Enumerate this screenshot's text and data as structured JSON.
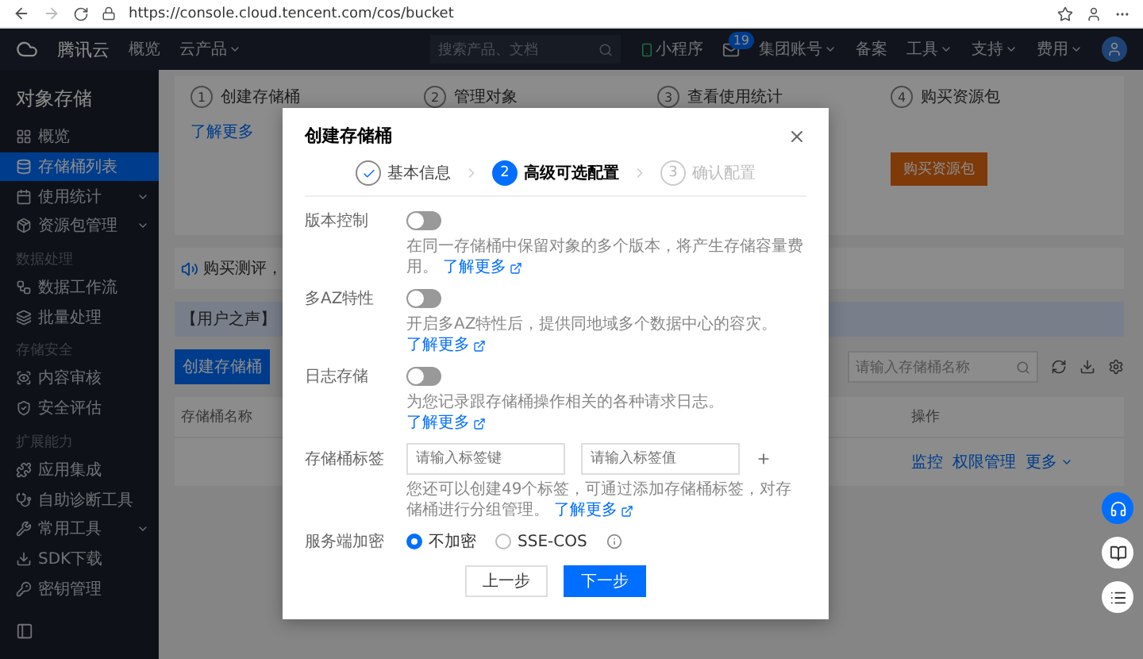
{
  "browser": {
    "url": "https://console.cloud.tencent.com/cos/bucket"
  },
  "topnav": {
    "brand": "腾讯云",
    "links": [
      {
        "label": "概览",
        "dropdown": false
      },
      {
        "label": "云产品",
        "dropdown": true
      }
    ],
    "search": {
      "placeholder": "搜索产品、文档"
    },
    "items": [
      {
        "kind": "mini",
        "label": "小程序"
      },
      {
        "kind": "mail",
        "badge": "19"
      },
      {
        "kind": "link",
        "label": "集团账号",
        "dropdown": true
      },
      {
        "kind": "link",
        "label": "备案",
        "dropdown": false
      },
      {
        "kind": "link",
        "label": "工具",
        "dropdown": true
      },
      {
        "kind": "link",
        "label": "支持",
        "dropdown": true
      },
      {
        "kind": "link",
        "label": "费用",
        "dropdown": true
      },
      {
        "kind": "avatar"
      }
    ]
  },
  "sidebar": {
    "title": "对象存储",
    "groups": [
      {
        "items": [
          {
            "label": "概览",
            "selected": false,
            "expandable": false
          },
          {
            "label": "存储桶列表",
            "selected": true,
            "expandable": false
          },
          {
            "label": "使用统计",
            "selected": false,
            "expandable": true
          },
          {
            "label": "资源包管理",
            "selected": false,
            "expandable": true
          }
        ]
      },
      {
        "heading": "数据处理",
        "items": [
          {
            "label": "数据工作流",
            "selected": false,
            "expandable": false
          },
          {
            "label": "批量处理",
            "selected": false,
            "expandable": false
          }
        ]
      },
      {
        "heading": "存储安全",
        "items": [
          {
            "label": "内容审核",
            "selected": false,
            "expandable": false
          },
          {
            "label": "安全评估",
            "selected": false,
            "expandable": false
          }
        ]
      },
      {
        "heading": "扩展能力",
        "items": [
          {
            "label": "应用集成",
            "selected": false,
            "expandable": false
          },
          {
            "label": "自助诊断工具",
            "selected": false,
            "expandable": false
          },
          {
            "label": "常用工具",
            "selected": false,
            "expandable": true
          },
          {
            "label": "SDK下载",
            "selected": false,
            "expandable": false
          },
          {
            "label": "密钥管理",
            "selected": false,
            "expandable": false
          }
        ]
      }
    ]
  },
  "guide": [
    {
      "number": "1",
      "title": "创建存储桶",
      "link": "了解更多"
    },
    {
      "number": "2",
      "title": "管理对象"
    },
    {
      "number": "3",
      "title": "查看使用统计"
    },
    {
      "number": "4",
      "title": "购买资源包",
      "button": "购买资源包"
    }
  ],
  "notice": "购买测评，",
  "voice": "【用户之声】",
  "toolbar": {
    "create": "创建存储桶",
    "search": {
      "placeholder": "请输入存储桶名称"
    }
  },
  "table": {
    "columns": [
      "存储桶名称",
      "操作"
    ],
    "rows": [
      {
        "actions": [
          {
            "label": "监控",
            "dropdown": false
          },
          {
            "label": "权限管理",
            "dropdown": false
          },
          {
            "label": "更多",
            "dropdown": true
          }
        ]
      }
    ]
  },
  "modal": {
    "title": "创建存储桶",
    "steps": [
      {
        "label": "基本信息",
        "done": true,
        "selected": false
      },
      {
        "number": "2",
        "label": "高级可选配置",
        "done": false,
        "selected": true
      },
      {
        "number": "3",
        "label": "确认配置",
        "done": false,
        "selected": false
      }
    ],
    "fields": [
      {
        "kind": "toggle",
        "label": "版本控制",
        "on": false,
        "hint": "在同一存储桶中保留对象的多个版本，将产生存储容量费用。",
        "link": "了解更多"
      },
      {
        "kind": "toggle",
        "label": "多AZ特性",
        "on": false,
        "hint": "开启多AZ特性后，提供同地域多个数据中心的容灾。",
        "link": "了解更多"
      },
      {
        "kind": "toggle",
        "label": "日志存储",
        "on": false,
        "hint": "为您记录跟存储桶操作相关的各种请求日志。",
        "link": "了解更多"
      },
      {
        "kind": "tags",
        "label": "存储桶标签",
        "key_placeholder": "请输入标签键",
        "value_placeholder": "请输入标签值",
        "hint": "您还可以创建49个标签，可通过添加存储桶标签，对存储桶进行分组管理。",
        "link": "了解更多"
      },
      {
        "kind": "radio",
        "label": "服务端加密",
        "options": [
          {
            "label": "不加密",
            "selected": true
          },
          {
            "label": "SSE-COS",
            "selected": false
          }
        ]
      }
    ],
    "buttons": [
      {
        "label": "上一步",
        "primary": false
      },
      {
        "label": "下一步",
        "primary": true
      }
    ]
  }
}
